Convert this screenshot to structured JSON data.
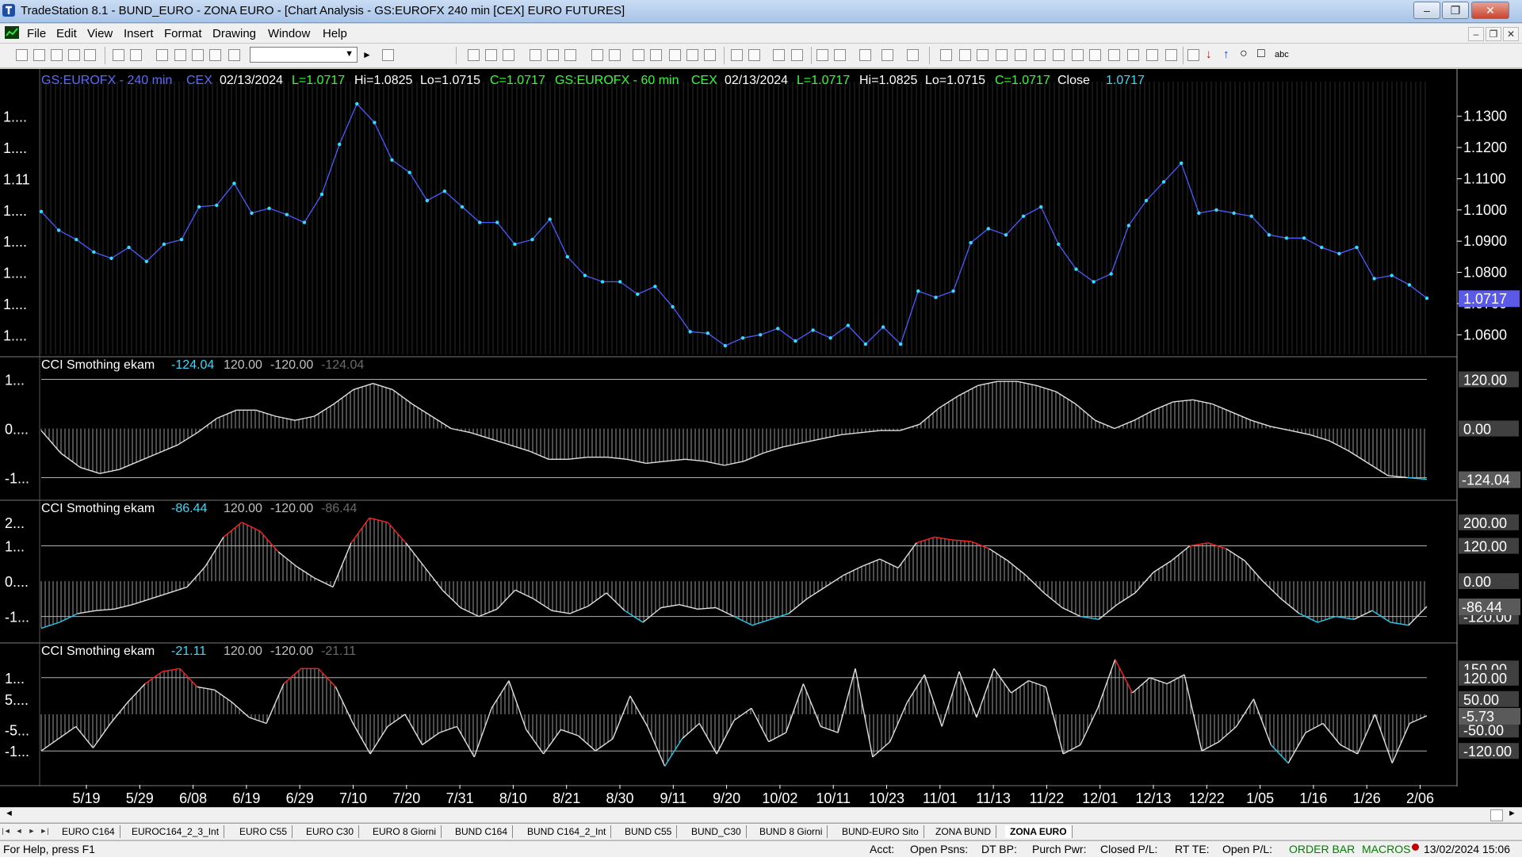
{
  "window": {
    "title": "TradeStation 8.1 - BUND_EURO - ZONA EURO - [Chart Analysis - GS:EUROFX  240 min  [CEX] EURO FUTURES]",
    "minimize": "–",
    "restore": "❐",
    "close": "✕"
  },
  "menu": [
    "File",
    "Edit",
    "View",
    "Insert",
    "Format",
    "Drawing",
    "Window",
    "Help"
  ],
  "mdi_controls": [
    "–",
    "❐",
    "✕"
  ],
  "toolbar": {
    "symbol_combo": ""
  },
  "header": {
    "sym1": "GS:EUROFX - 240 min",
    "ex1": "CEX",
    "date1": "02/13/2024",
    "l1": "L=1.0717",
    "hi1": "Hi=1.0825",
    "lo1": "Lo=1.0715",
    "c1": "C=1.0717",
    "sym2": "GS:EUROFX - 60 min",
    "ex2": "CEX",
    "date2": "02/13/2024",
    "l2": "L=1.0717",
    "hi2": "Hi=1.0825",
    "lo2": "Lo=1.0715",
    "c2": "C=1.0717",
    "close_label": "Close",
    "close_value": "1.0717"
  },
  "price_left_labels": [
    "1....",
    "1....",
    "1.11",
    "1....",
    "1....",
    "1....",
    "1....",
    "1...."
  ],
  "price_right_labels": [
    "1.1300",
    "1.1200",
    "1.1100",
    "1.1000",
    "1.0900",
    "1.0800",
    "1.0700",
    "1.0600"
  ],
  "price_current": "1.0717",
  "panels": [
    {
      "title": "CCI Smothing ekam",
      "v1": "-124.04",
      "v2": "120.00",
      "v3": "-120.00",
      "v4": "-124.04",
      "left": [
        "1...",
        "0....",
        "-1..."
      ],
      "right": [
        "120.00",
        "0.00"
      ],
      "current": "-124.04"
    },
    {
      "title": "CCI Smothing ekam",
      "v1": "-86.44",
      "v2": "120.00",
      "v3": "-120.00",
      "v4": "-86.44",
      "left": [
        "2...",
        "1...",
        "0....",
        "-1..."
      ],
      "right": [
        "200.00",
        "120.00",
        "0.00",
        "-120.00"
      ],
      "current": "-86.44"
    },
    {
      "title": "CCI Smothing ekam",
      "v1": "-21.11",
      "v2": "120.00",
      "v3": "-120.00",
      "v4": "-21.11",
      "left": [
        "1...",
        "5....",
        "-5...",
        "-1..."
      ],
      "right": [
        "150.00",
        "120.00",
        "50.00",
        "-50.00",
        "-120.00"
      ],
      "current": "-5.73"
    }
  ],
  "x_labels": [
    "5/19",
    "5/29",
    "6/08",
    "6/19",
    "6/29",
    "7/10",
    "7/20",
    "7/31",
    "8/10",
    "8/21",
    "8/30",
    "9/11",
    "9/20",
    "10/02",
    "10/11",
    "10/23",
    "11/01",
    "11/13",
    "11/22",
    "12/01",
    "12/13",
    "12/22",
    "1/05",
    "1/16",
    "1/26",
    "2/06"
  ],
  "tabs": [
    "EURO C164",
    "EUROC164_2_3_Int",
    "EURO C55",
    "EURO C30",
    "EURO 8 Giorni",
    "BUND C164",
    "BUND C164_2_Int",
    "BUND C55",
    "BUND_C30",
    "BUND 8 Giorni",
    "BUND-EURO Sito",
    "ZONA BUND",
    "ZONA EURO"
  ],
  "status": {
    "help": "For Help, press F1",
    "acct": "Acct:",
    "open_psns": "Open Psns:",
    "dt_bp": "DT BP:",
    "purch_pwr": "Purch Pwr:",
    "closed_pl": "Closed P/L:",
    "rt_te": "RT TE:",
    "open_pl": "Open P/L:",
    "order_bar": "ORDER BAR",
    "macros": "MACROS",
    "datetime": "13/02/2024 15:06"
  },
  "chart_data": {
    "type": "line",
    "x_labels": [
      "5/19",
      "5/29",
      "6/08",
      "6/19",
      "6/29",
      "7/10",
      "7/20",
      "7/31",
      "8/10",
      "8/21",
      "8/30",
      "9/11",
      "9/20",
      "10/02",
      "10/11",
      "10/23",
      "11/01",
      "11/13",
      "11/22",
      "12/01",
      "12/13",
      "12/22",
      "1/05",
      "1/16",
      "1/26",
      "2/06"
    ],
    "price": {
      "name": "GS:EUROFX",
      "ylim": [
        1.055,
        1.135
      ],
      "values": [
        1.0995,
        1.0935,
        1.0905,
        1.0865,
        1.0845,
        1.088,
        1.0835,
        1.089,
        1.0905,
        1.101,
        1.1015,
        1.1085,
        1.099,
        1.1005,
        1.0985,
        1.096,
        1.105,
        1.121,
        1.134,
        1.128,
        1.116,
        1.112,
        1.103,
        1.106,
        1.101,
        1.096,
        1.096,
        1.089,
        1.0905,
        1.097,
        1.085,
        1.079,
        1.077,
        1.077,
        1.073,
        1.0755,
        1.069,
        1.061,
        1.0605,
        1.0565,
        1.059,
        1.06,
        1.062,
        1.058,
        1.0615,
        1.059,
        1.063,
        1.057,
        1.0625,
        1.057,
        1.074,
        1.072,
        1.074,
        1.0895,
        1.094,
        1.092,
        1.098,
        1.101,
        1.089,
        1.081,
        1.077,
        1.0795,
        1.095,
        1.103,
        1.109,
        1.115,
        1.099,
        1.1,
        1.099,
        1.098,
        1.092,
        1.091,
        1.091,
        1.088,
        1.086,
        1.088,
        1.078,
        1.079,
        1.076,
        1.0717
      ]
    },
    "cci1": {
      "ylim": [
        -150,
        150
      ],
      "values": [
        -5,
        -60,
        -95,
        -110,
        -100,
        -80,
        -60,
        -40,
        -10,
        25,
        45,
        45,
        30,
        20,
        30,
        60,
        95,
        110,
        95,
        60,
        30,
        0,
        -10,
        -25,
        -40,
        -55,
        -75,
        -75,
        -70,
        -70,
        -75,
        -85,
        -80,
        -75,
        -80,
        -90,
        -80,
        -60,
        -45,
        -35,
        -25,
        -15,
        -10,
        -5,
        -5,
        10,
        50,
        80,
        105,
        115,
        115,
        105,
        90,
        60,
        20,
        0,
        20,
        45,
        65,
        70,
        60,
        40,
        20,
        5,
        -5,
        -15,
        -30,
        -55,
        -85,
        -115,
        -120,
        -124
      ]
    },
    "cci2": {
      "ylim": [
        -175,
        240
      ],
      "values": [
        -160,
        -140,
        -110,
        -100,
        -95,
        -80,
        -60,
        -40,
        -20,
        50,
        150,
        200,
        170,
        100,
        50,
        10,
        -20,
        130,
        215,
        200,
        130,
        50,
        -30,
        -90,
        -120,
        -95,
        -30,
        -60,
        -100,
        -110,
        -85,
        -40,
        -100,
        -140,
        -90,
        -80,
        -95,
        -90,
        -120,
        -150,
        -130,
        -110,
        -60,
        -20,
        20,
        50,
        75,
        45,
        130,
        150,
        140,
        135,
        110,
        70,
        20,
        -40,
        -90,
        -120,
        -130,
        -80,
        -40,
        30,
        70,
        120,
        130,
        110,
        70,
        0,
        -60,
        -110,
        -140,
        -120,
        -130,
        -100,
        -140,
        -150,
        -86
      ]
    },
    "cci3": {
      "ylim": [
        -200,
        200
      ],
      "values": [
        -120,
        -80,
        -40,
        -110,
        -30,
        40,
        100,
        140,
        150,
        90,
        80,
        40,
        -10,
        -30,
        100,
        150,
        150,
        90,
        -30,
        -130,
        -40,
        0,
        -100,
        -60,
        -40,
        -140,
        20,
        110,
        -50,
        -130,
        -50,
        -70,
        -120,
        -80,
        60,
        -40,
        -170,
        -80,
        -30,
        -130,
        -20,
        20,
        -90,
        -60,
        100,
        -40,
        -60,
        150,
        -140,
        -90,
        40,
        130,
        -40,
        140,
        -10,
        150,
        70,
        110,
        90,
        -130,
        -100,
        20,
        180,
        70,
        120,
        100,
        130,
        -120,
        -90,
        -40,
        50,
        -100,
        -160,
        -60,
        -30,
        -100,
        -130,
        0,
        -160,
        -30,
        -5
      ]
    }
  }
}
